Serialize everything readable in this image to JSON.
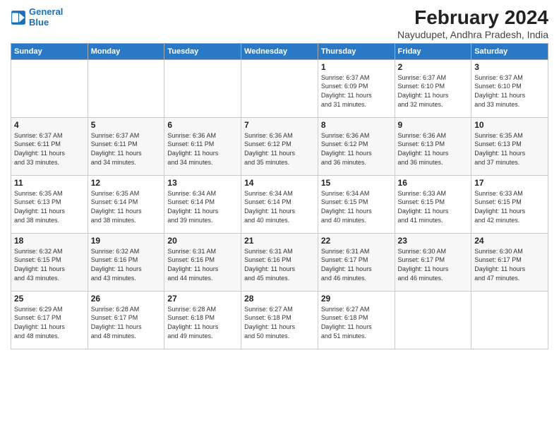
{
  "logo": {
    "line1": "General",
    "line2": "Blue"
  },
  "title": "February 2024",
  "subtitle": "Nayudupet, Andhra Pradesh, India",
  "days_of_week": [
    "Sunday",
    "Monday",
    "Tuesday",
    "Wednesday",
    "Thursday",
    "Friday",
    "Saturday"
  ],
  "weeks": [
    [
      {
        "day": "",
        "info": ""
      },
      {
        "day": "",
        "info": ""
      },
      {
        "day": "",
        "info": ""
      },
      {
        "day": "",
        "info": ""
      },
      {
        "day": "1",
        "info": "Sunrise: 6:37 AM\nSunset: 6:09 PM\nDaylight: 11 hours\nand 31 minutes."
      },
      {
        "day": "2",
        "info": "Sunrise: 6:37 AM\nSunset: 6:10 PM\nDaylight: 11 hours\nand 32 minutes."
      },
      {
        "day": "3",
        "info": "Sunrise: 6:37 AM\nSunset: 6:10 PM\nDaylight: 11 hours\nand 33 minutes."
      }
    ],
    [
      {
        "day": "4",
        "info": "Sunrise: 6:37 AM\nSunset: 6:11 PM\nDaylight: 11 hours\nand 33 minutes."
      },
      {
        "day": "5",
        "info": "Sunrise: 6:37 AM\nSunset: 6:11 PM\nDaylight: 11 hours\nand 34 minutes."
      },
      {
        "day": "6",
        "info": "Sunrise: 6:36 AM\nSunset: 6:11 PM\nDaylight: 11 hours\nand 34 minutes."
      },
      {
        "day": "7",
        "info": "Sunrise: 6:36 AM\nSunset: 6:12 PM\nDaylight: 11 hours\nand 35 minutes."
      },
      {
        "day": "8",
        "info": "Sunrise: 6:36 AM\nSunset: 6:12 PM\nDaylight: 11 hours\nand 36 minutes."
      },
      {
        "day": "9",
        "info": "Sunrise: 6:36 AM\nSunset: 6:13 PM\nDaylight: 11 hours\nand 36 minutes."
      },
      {
        "day": "10",
        "info": "Sunrise: 6:35 AM\nSunset: 6:13 PM\nDaylight: 11 hours\nand 37 minutes."
      }
    ],
    [
      {
        "day": "11",
        "info": "Sunrise: 6:35 AM\nSunset: 6:13 PM\nDaylight: 11 hours\nand 38 minutes."
      },
      {
        "day": "12",
        "info": "Sunrise: 6:35 AM\nSunset: 6:14 PM\nDaylight: 11 hours\nand 38 minutes."
      },
      {
        "day": "13",
        "info": "Sunrise: 6:34 AM\nSunset: 6:14 PM\nDaylight: 11 hours\nand 39 minutes."
      },
      {
        "day": "14",
        "info": "Sunrise: 6:34 AM\nSunset: 6:14 PM\nDaylight: 11 hours\nand 40 minutes."
      },
      {
        "day": "15",
        "info": "Sunrise: 6:34 AM\nSunset: 6:15 PM\nDaylight: 11 hours\nand 40 minutes."
      },
      {
        "day": "16",
        "info": "Sunrise: 6:33 AM\nSunset: 6:15 PM\nDaylight: 11 hours\nand 41 minutes."
      },
      {
        "day": "17",
        "info": "Sunrise: 6:33 AM\nSunset: 6:15 PM\nDaylight: 11 hours\nand 42 minutes."
      }
    ],
    [
      {
        "day": "18",
        "info": "Sunrise: 6:32 AM\nSunset: 6:15 PM\nDaylight: 11 hours\nand 43 minutes."
      },
      {
        "day": "19",
        "info": "Sunrise: 6:32 AM\nSunset: 6:16 PM\nDaylight: 11 hours\nand 43 minutes."
      },
      {
        "day": "20",
        "info": "Sunrise: 6:31 AM\nSunset: 6:16 PM\nDaylight: 11 hours\nand 44 minutes."
      },
      {
        "day": "21",
        "info": "Sunrise: 6:31 AM\nSunset: 6:16 PM\nDaylight: 11 hours\nand 45 minutes."
      },
      {
        "day": "22",
        "info": "Sunrise: 6:31 AM\nSunset: 6:17 PM\nDaylight: 11 hours\nand 46 minutes."
      },
      {
        "day": "23",
        "info": "Sunrise: 6:30 AM\nSunset: 6:17 PM\nDaylight: 11 hours\nand 46 minutes."
      },
      {
        "day": "24",
        "info": "Sunrise: 6:30 AM\nSunset: 6:17 PM\nDaylight: 11 hours\nand 47 minutes."
      }
    ],
    [
      {
        "day": "25",
        "info": "Sunrise: 6:29 AM\nSunset: 6:17 PM\nDaylight: 11 hours\nand 48 minutes."
      },
      {
        "day": "26",
        "info": "Sunrise: 6:28 AM\nSunset: 6:17 PM\nDaylight: 11 hours\nand 48 minutes."
      },
      {
        "day": "27",
        "info": "Sunrise: 6:28 AM\nSunset: 6:18 PM\nDaylight: 11 hours\nand 49 minutes."
      },
      {
        "day": "28",
        "info": "Sunrise: 6:27 AM\nSunset: 6:18 PM\nDaylight: 11 hours\nand 50 minutes."
      },
      {
        "day": "29",
        "info": "Sunrise: 6:27 AM\nSunset: 6:18 PM\nDaylight: 11 hours\nand 51 minutes."
      },
      {
        "day": "",
        "info": ""
      },
      {
        "day": "",
        "info": ""
      }
    ]
  ]
}
